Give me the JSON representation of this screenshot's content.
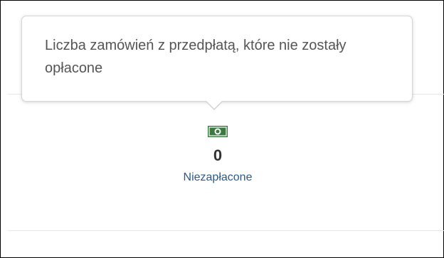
{
  "tooltip": {
    "text": "Liczba zamówień z przedpłatą, które nie zostały opłacone"
  },
  "stat": {
    "icon": "money-icon",
    "value": "0",
    "label": "Niezapłacone"
  },
  "colors": {
    "icon": "#3b7a3e",
    "label_link": "#2a5a8c",
    "tooltip_text": "#555555"
  }
}
